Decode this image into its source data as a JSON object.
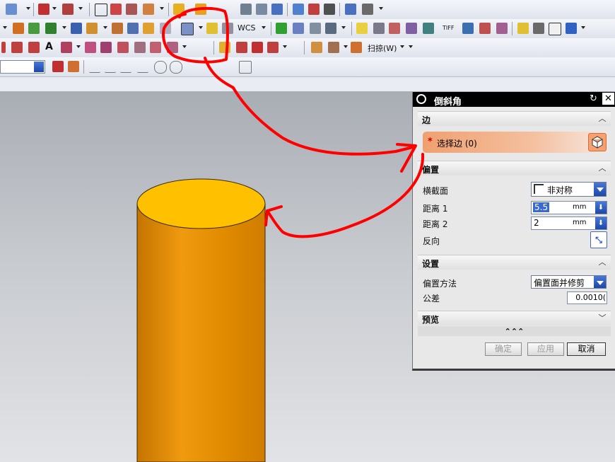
{
  "toolbar": {
    "wcs_label": "WCS",
    "tiff_label": "TIFF",
    "sweep_label": "扫掠(W)"
  },
  "dialog": {
    "title": "倒斜角",
    "edge_section": {
      "header": "边",
      "select_edge_required": "*",
      "select_edge_label": "选择边 (0)"
    },
    "offset_section": {
      "header": "偏置",
      "cross_section_label": "横截面",
      "cross_section_value": "非对称",
      "distance1_label": "距离 1",
      "distance1_value": "5.5",
      "distance1_unit": "mm",
      "distance2_label": "距离 2",
      "distance2_value": "2",
      "distance2_unit": "mm",
      "reverse_label": "反向"
    },
    "settings_section": {
      "header": "设置",
      "offset_method_label": "偏置方法",
      "offset_method_value": "偏置面并修剪",
      "tolerance_label": "公差",
      "tolerance_value": "0.0010("
    },
    "preview_section": {
      "header": "预览"
    },
    "more_glyph": "⌃⌃⌃",
    "buttons": {
      "ok": "确定",
      "apply": "应用",
      "cancel": "取消"
    }
  },
  "colors": {
    "cylinder_side": "#e08a00",
    "cylinder_top": "#ffc000",
    "annotation": "#ff0000",
    "select_highlight": "#f2a070"
  }
}
